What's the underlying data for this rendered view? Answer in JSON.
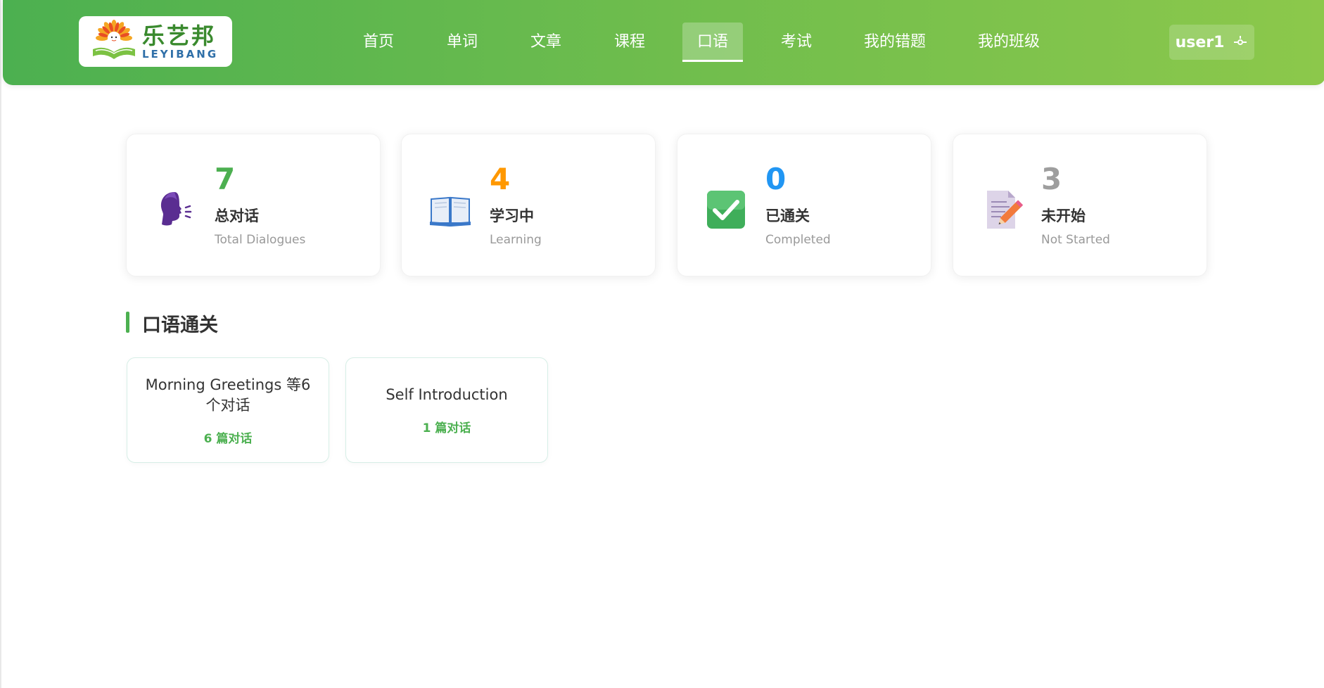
{
  "brand": {
    "name_cn": "乐艺邦",
    "name_en": "LEYIBANG"
  },
  "nav": {
    "items": [
      {
        "label": "首页"
      },
      {
        "label": "单词"
      },
      {
        "label": "文章"
      },
      {
        "label": "课程"
      },
      {
        "label": "口语",
        "active": true
      },
      {
        "label": "考试"
      },
      {
        "label": "我的错题"
      },
      {
        "label": "我的班级"
      }
    ]
  },
  "user": {
    "name": "user1",
    "icon": "logout-icon"
  },
  "stats": [
    {
      "value": "7",
      "label": "总对话",
      "sub": "Total Dialogues",
      "color": "#4caf50",
      "icon": "speaking-head-icon"
    },
    {
      "value": "4",
      "label": "学习中",
      "sub": "Learning",
      "color": "#ff9800",
      "icon": "open-book-icon"
    },
    {
      "value": "0",
      "label": "已通关",
      "sub": "Completed",
      "color": "#2196f3",
      "icon": "check-box-icon"
    },
    {
      "value": "3",
      "label": "未开始",
      "sub": "Not Started",
      "color": "#9e9e9e",
      "icon": "memo-icon"
    }
  ],
  "section": {
    "title": "口语通关"
  },
  "lessons": [
    {
      "title": "Morning Greetings 等6个对话",
      "count": "6 篇对话"
    },
    {
      "title": "Self Introduction",
      "count": "1 篇对话"
    }
  ],
  "colors": {
    "accent": "#4cb050",
    "header_start": "#4cb050",
    "header_end": "#8cc84b"
  }
}
